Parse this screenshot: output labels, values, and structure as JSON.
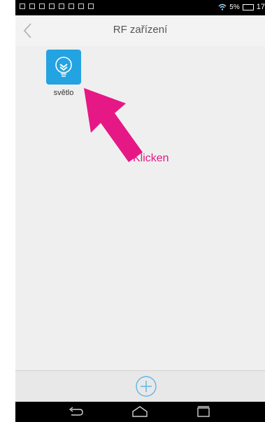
{
  "status_bar": {
    "battery_percent": "5%",
    "time": "17"
  },
  "header": {
    "title": "RF zařízení"
  },
  "devices": [
    {
      "label": "světlo",
      "icon": "bulb-icon",
      "tile_color": "#23a3e2"
    }
  ],
  "annotation": {
    "text": "Klicken",
    "color": "#e61886"
  },
  "bottom_bar": {
    "add_icon": "plus-circle-icon",
    "accent": "#5fb6e8"
  },
  "navigation": {
    "buttons": [
      "back-icon",
      "home-icon",
      "recent-apps-icon"
    ]
  }
}
